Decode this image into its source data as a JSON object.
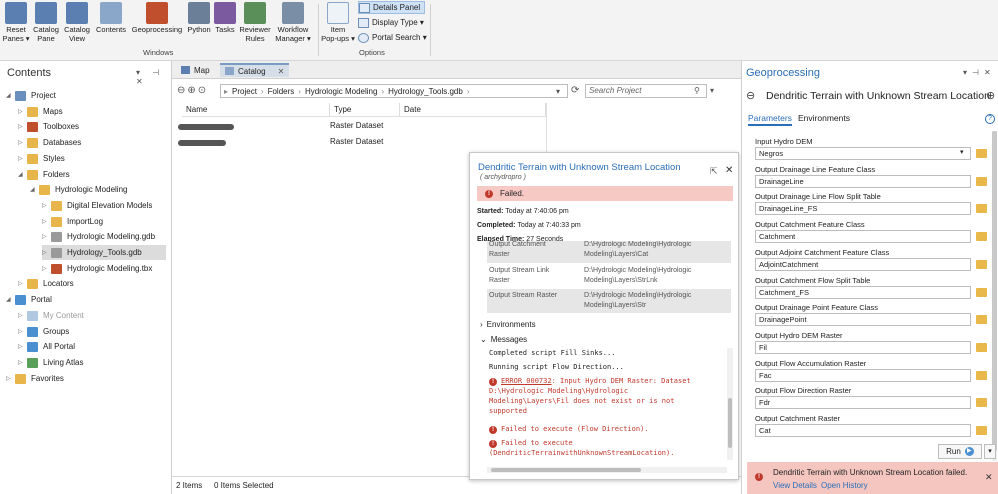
{
  "ribbon": {
    "windows_buttons": [
      {
        "label1": "Reset",
        "label2": "Panes ▾",
        "icon": "reset-panes-icon",
        "color": "#5b7fb0"
      },
      {
        "label1": "Catalog",
        "label2": "Pane",
        "icon": "catalog-pane-icon",
        "color": "#5b7fb0"
      },
      {
        "label1": "Catalog",
        "label2": "View",
        "icon": "catalog-view-icon",
        "color": "#5b7fb0"
      },
      {
        "label1": "Contents",
        "label2": "",
        "icon": "contents-icon",
        "color": "#8aa6c8"
      },
      {
        "label1": "Geoprocessing",
        "label2": "",
        "icon": "geoprocessing-icon",
        "color": "#c0502d"
      },
      {
        "label1": "Python",
        "label2": "",
        "icon": "python-icon",
        "color": "#6c7f99"
      },
      {
        "label1": "Tasks",
        "label2": "",
        "icon": "tasks-icon",
        "color": "#7c5aa0"
      },
      {
        "label1": "Reviewer",
        "label2": "Rules",
        "icon": "reviewer-rules-icon",
        "color": "#5a8f5a"
      },
      {
        "label1": "Workflow",
        "label2": "Manager ▾",
        "icon": "workflow-manager-icon",
        "color": "#7a8fa6"
      }
    ],
    "windows_group_label": "Windows",
    "item_popups": {
      "label1": "Item",
      "label2": "Pop-ups ▾"
    },
    "options": {
      "details_panel": "Details Panel",
      "display_type": "Display Type ▾",
      "portal_search": "Portal Search ▾",
      "group_label": "Options"
    }
  },
  "contents": {
    "title": "Contents",
    "controls": "▾ ⊣ ✕",
    "tree": [
      {
        "label": "Project",
        "level": 0,
        "expanded": true,
        "icon": "project-icon",
        "color": "#6a8fbf"
      },
      {
        "label": "Maps",
        "level": 1,
        "icon": "maps-folder-icon",
        "color": "#e7b54a"
      },
      {
        "label": "Toolboxes",
        "level": 1,
        "icon": "toolboxes-folder-icon",
        "color": "#c0502d"
      },
      {
        "label": "Databases",
        "level": 1,
        "icon": "databases-folder-icon",
        "color": "#e7b54a"
      },
      {
        "label": "Styles",
        "level": 1,
        "icon": "styles-folder-icon",
        "color": "#e7b54a"
      },
      {
        "label": "Folders",
        "level": 1,
        "expanded": true,
        "icon": "folders-icon",
        "color": "#e7b54a"
      },
      {
        "label": "Hydrologic Modeling",
        "level": 2,
        "expanded": true,
        "icon": "folder-icon",
        "color": "#e7b54a"
      },
      {
        "label": "Digital Elevation Models",
        "level": 3,
        "icon": "folder-icon",
        "color": "#e7b54a"
      },
      {
        "label": "ImportLog",
        "level": 3,
        "icon": "folder-icon",
        "color": "#e7b54a"
      },
      {
        "label": "Hydrologic Modeling.gdb",
        "level": 3,
        "icon": "geodatabase-icon",
        "color": "#9a9a9a"
      },
      {
        "label": "Hydrology_Tools.gdb",
        "level": 3,
        "selected": true,
        "icon": "geodatabase-icon",
        "color": "#9a9a9a"
      },
      {
        "label": "Hydrologic Modeling.tbx",
        "level": 3,
        "icon": "toolbox-icon",
        "color": "#c0502d"
      },
      {
        "label": "Locators",
        "level": 1,
        "icon": "locators-icon",
        "color": "#e7b54a"
      },
      {
        "label": "Portal",
        "level": 0,
        "expanded": true,
        "icon": "portal-icon",
        "color": "#4a8fd0"
      },
      {
        "label": "My Content",
        "level": 1,
        "muted": true,
        "icon": "my-content-icon",
        "color": "#b0c8e0"
      },
      {
        "label": "Groups",
        "level": 1,
        "icon": "groups-icon",
        "color": "#4a8fd0"
      },
      {
        "label": "All Portal",
        "level": 1,
        "icon": "all-portal-icon",
        "color": "#4a8fd0"
      },
      {
        "label": "Living Atlas",
        "level": 1,
        "icon": "living-atlas-icon",
        "color": "#5aa05a"
      },
      {
        "label": "Favorites",
        "level": 0,
        "icon": "favorites-icon",
        "color": "#e7b54a"
      }
    ]
  },
  "center": {
    "tabs": [
      {
        "label": "Map"
      },
      {
        "label": "Catalog"
      }
    ],
    "path": [
      "Project",
      "Folders",
      "Hydrologic Modeling",
      "Hydrology_Tools.gdb"
    ],
    "search_placeholder": "Search Project",
    "columns": {
      "name": "Name",
      "type": "Type",
      "date": "Date"
    },
    "rows": [
      {
        "type": "Raster Dataset"
      },
      {
        "type": "Raster Dataset"
      }
    ],
    "status": {
      "items": "2 Items",
      "selected": "0 Items Selected"
    }
  },
  "popup": {
    "title": "Dendritic Terrain with Unknown Stream Location",
    "subtitle": "( archydropro )",
    "failed": "Failed.",
    "started_label": "Started:",
    "started_value": "Today at 7:40:06 pm",
    "completed_label": "Completed:",
    "completed_value": "Today at 7:40:33 pm",
    "elapsed_label": "Elapsed Time:",
    "elapsed_value": "27 Seconds",
    "params": [
      {
        "name1": "Output Catchment",
        "name2": "Raster",
        "value1": "D:\\Hydrologic Modeling\\Hydrologic",
        "value2": "Modeling\\Layers\\Cat"
      },
      {
        "name1": "Output Stream Link",
        "name2": "Raster",
        "value1": "D:\\Hydrologic Modeling\\Hydrologic",
        "value2": "Modeling\\Layers\\StrLnk"
      },
      {
        "name1": "Output Stream Raster",
        "name2": "",
        "value1": "D:\\Hydrologic Modeling\\Hydrologic",
        "value2": "Modeling\\Layers\\Str"
      }
    ],
    "environments": "Environments",
    "messages": "Messages",
    "msg1": "Completed script Fill Sinks...",
    "msg2": "Running script Flow Direction...",
    "err_code": "ERROR 000732",
    "err_rest1": ": Input Hydro DEM Raster: Dataset",
    "err_line2": "D:\\Hydrologic Modeling\\Hydrologic",
    "err_line3": "Modeling\\Layers\\Fil does not exist or is not",
    "err_line4": "supported",
    "fail1": "Failed to execute (Flow Direction).",
    "fail2a": "Failed to execute",
    "fail2b": "(DendriticTerrainwithUnknownStreamLocation)."
  },
  "gp": {
    "title": "Geoprocessing",
    "tool_title": "Dendritic Terrain with Unknown Stream Location",
    "tabs": {
      "parameters": "Parameters",
      "environments": "Environments"
    },
    "params": [
      {
        "label": "Input Hydro DEM",
        "value": "Negros",
        "dropdown": true
      },
      {
        "label": "Output Drainage Line Feature Class",
        "value": "DrainageLine"
      },
      {
        "label": "Output Drainage Line Flow Split Table",
        "value": "DrainageLine_FS"
      },
      {
        "label": "Output Catchment Feature Class",
        "value": "Catchment"
      },
      {
        "label": "Output Adjoint Catchment Feature Class",
        "value": "AdjointCatchment"
      },
      {
        "label": "Output Catchment Flow Split Table",
        "value": "Catchment_FS"
      },
      {
        "label": "Output Drainage Point Feature Class",
        "value": "DrainagePoint"
      },
      {
        "label": "Output Hydro DEM Raster",
        "value": "Fil"
      },
      {
        "label": "Output Flow Accumulation Raster",
        "value": "Fac"
      },
      {
        "label": "Output Flow Direction Raster",
        "value": "Fdr"
      },
      {
        "label": "Output Catchment Raster",
        "value": "Cat"
      }
    ],
    "run": "Run",
    "notice": {
      "text": "Dendritic Terrain with Unknown Stream Location failed.",
      "view_details": "View Details",
      "open_history": "Open History"
    }
  },
  "colors": {
    "accent_blue": "#2a6eb8",
    "error_red": "#c0392b",
    "failed_bg": "#f7c9c4",
    "notice_bg": "#f5c6c0"
  }
}
